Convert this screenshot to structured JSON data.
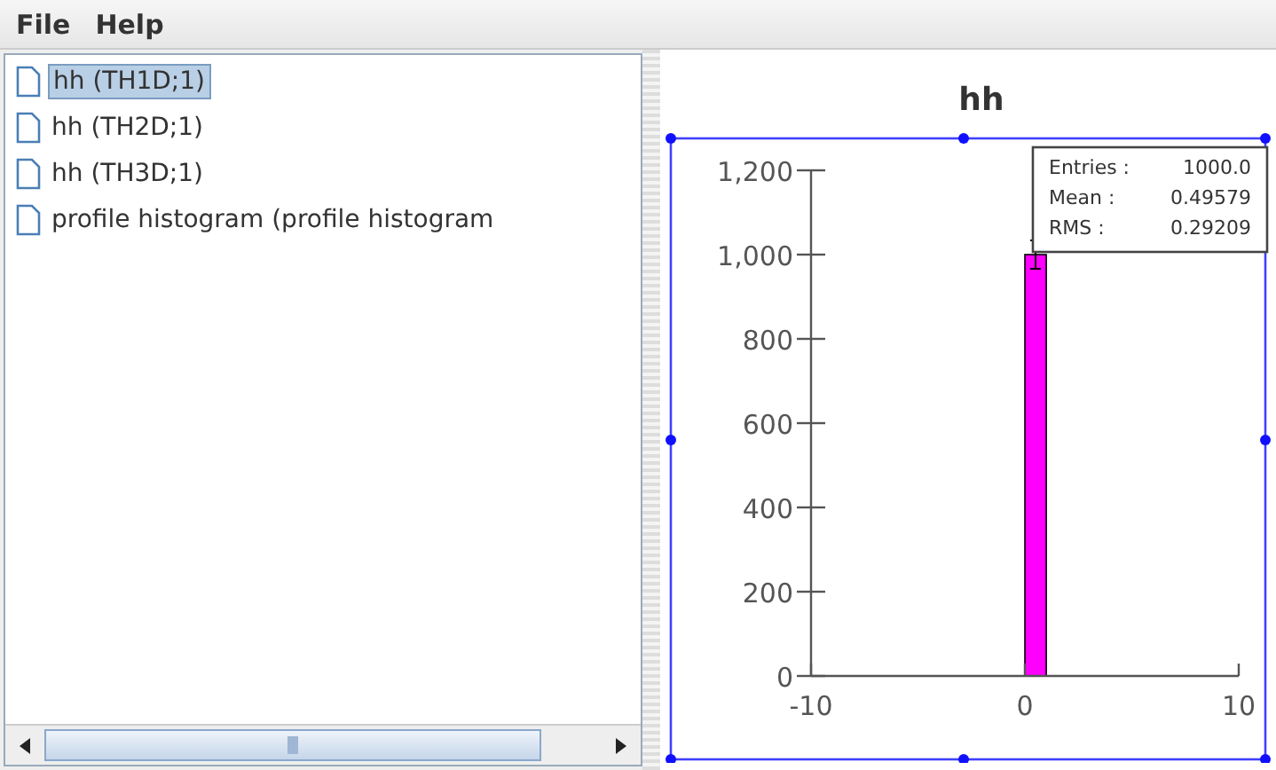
{
  "menu": [
    {
      "label": "File"
    },
    {
      "label": "Help"
    }
  ],
  "tree": {
    "items": [
      {
        "label": "hh (TH1D;1)",
        "selected": true
      },
      {
        "label": "hh (TH2D;1)",
        "selected": false
      },
      {
        "label": "hh (TH3D;1)",
        "selected": false
      },
      {
        "label": "profile histogram (profile histogram",
        "selected": false
      }
    ]
  },
  "plot": {
    "stats": [
      {
        "name": "Entries :",
        "value": "1000.0"
      },
      {
        "name": "Mean :",
        "value": "0.49579"
      },
      {
        "name": "RMS :",
        "value": "0.29209"
      }
    ],
    "chart_data": {
      "type": "bar",
      "title": "hh",
      "x": [
        0.5
      ],
      "series": [
        {
          "color": "#ff00ff",
          "values": [
            1000
          ]
        }
      ],
      "xlim": [
        -10,
        10
      ],
      "ylim": [
        0,
        1200
      ],
      "xticks": [
        -10,
        0,
        10
      ],
      "yticks": [
        0,
        200,
        400,
        600,
        800,
        {
          "value": 1000,
          "label": "1,000"
        },
        {
          "value": 1200,
          "label": "1,200"
        }
      ]
    }
  }
}
